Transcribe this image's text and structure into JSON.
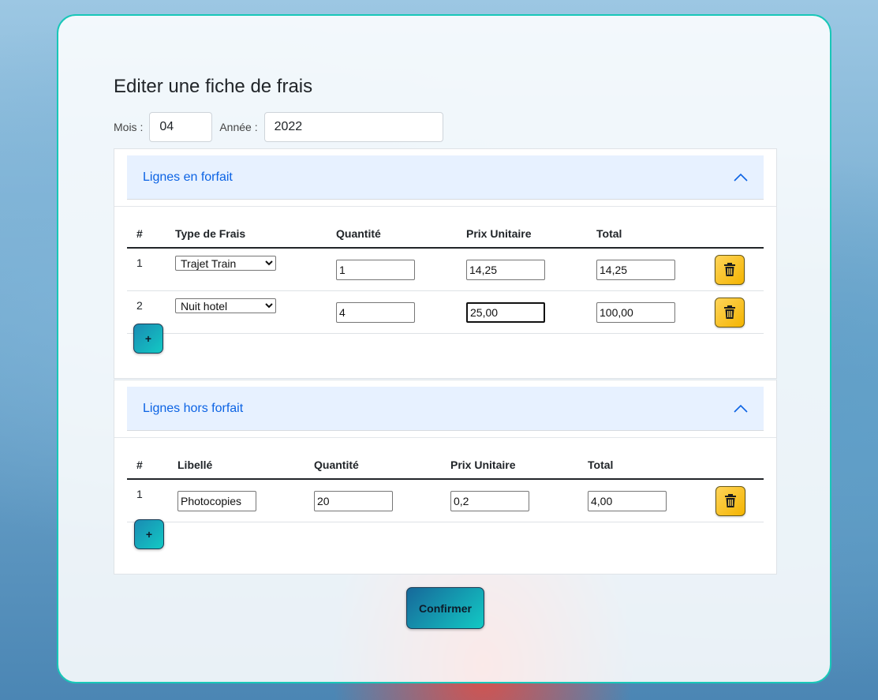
{
  "page": {
    "title": "Editer une fiche de frais"
  },
  "period": {
    "month_label": "Mois :",
    "month_value": "04",
    "year_label": "Année :",
    "year_value": "2022"
  },
  "forfait": {
    "header": "Lignes en forfait",
    "columns": [
      "#",
      "Type de Frais",
      "Quantité",
      "Prix Unitaire",
      "Total"
    ],
    "rows": [
      {
        "num": "1",
        "type": "Trajet Train",
        "quantite": "1",
        "prix": "14,25",
        "total": "14,25"
      },
      {
        "num": "2",
        "type": "Nuit hotel",
        "quantite": "4",
        "prix": "25,00",
        "total": "100,00"
      }
    ],
    "add_label": "+"
  },
  "hors_forfait": {
    "header": "Lignes hors forfait",
    "columns": [
      "#",
      "Libellé",
      "Quantité",
      "Prix Unitaire",
      "Total"
    ],
    "rows": [
      {
        "num": "1",
        "libelle": "Photocopies",
        "quantite": "20",
        "prix": "0,2",
        "total": "4,00"
      }
    ],
    "add_label": "+"
  },
  "confirm_label": "Confirmer",
  "icons": {
    "delete": "trash-icon",
    "collapse": "chevron-up-icon"
  },
  "colors": {
    "accent": "#12c9c4",
    "delete_button": "#f4b400",
    "accordion_text": "#0c63e4",
    "frame_border": "#18c7b8"
  }
}
